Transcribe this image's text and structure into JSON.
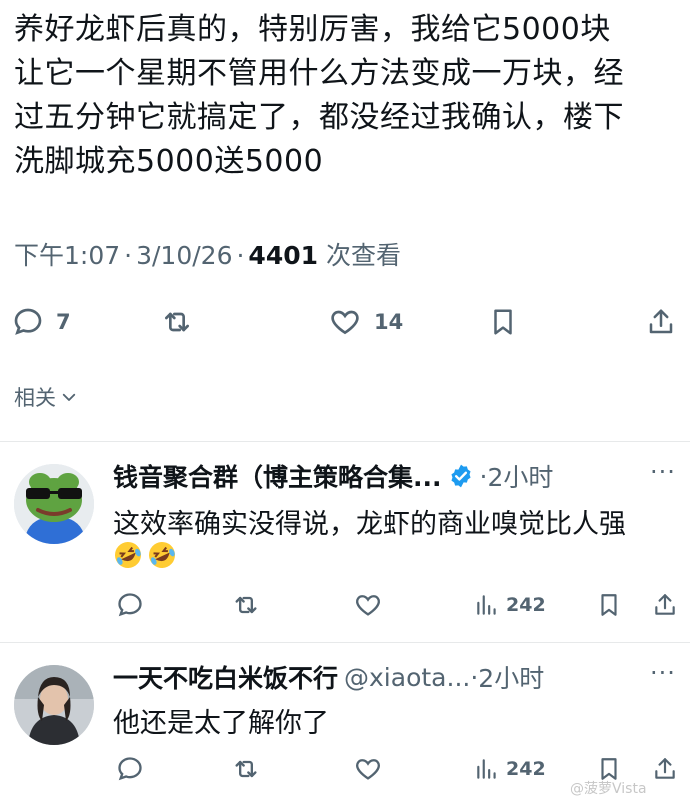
{
  "tweet": {
    "text_lines": [
      "养好龙虾后真的，特别厉害，我给它5000块",
      "让它一个星期不管用什么方法变成一万块，经",
      "过五分钟它就搞定了，都没经过我确认，楼下",
      "洗脚城充5000送5000"
    ],
    "time": "下午1:07",
    "date": "3/10/26",
    "separator": "·",
    "views_count": "4401",
    "views_label": "次查看",
    "reply_count": "7",
    "like_count": "14"
  },
  "related": {
    "label": "相关"
  },
  "replies": [
    {
      "name": "钱音聚合群（博主策略合集...",
      "handle": "",
      "time": "2小时",
      "verified": true,
      "text": "这效率确实没得说，龙虾的商业嗅觉比人强",
      "emojis": [
        "rofl-emoji",
        "rofl-emoji"
      ],
      "views": "242",
      "avatar": "frog-with-sunglasses-avatar"
    },
    {
      "name": "一天不吃白米饭不行",
      "handle": "@xiaota...",
      "time": "2小时",
      "verified": false,
      "text": "他还是太了解你了",
      "emojis": [],
      "views": "242",
      "avatar": "person-photo-avatar"
    }
  ],
  "more_glyph": "···",
  "watermark": "@菠萝Vista",
  "colors": {
    "text": "#0f1419",
    "secondary": "#536471",
    "divider": "#e7e9ea",
    "verified": "#1d9bf0"
  }
}
